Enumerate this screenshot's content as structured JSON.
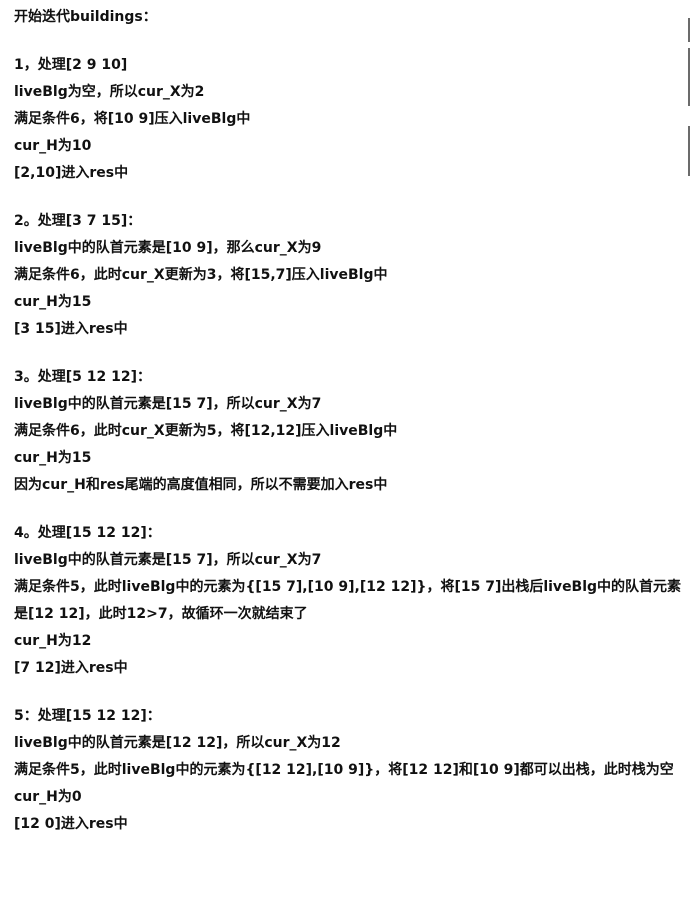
{
  "heading": "开始迭代buildings：",
  "sections": [
    {
      "lines": [
        "1，处理[2  9 10]",
        "liveBlg为空，所以cur_X为2",
        "满足条件6，将[10 9]压入liveBlg中",
        "cur_H为10",
        "[2,10]进入res中"
      ]
    },
    {
      "lines": [
        "2。处理[3 7 15]：",
        "liveBlg中的队首元素是[10 9]，那么cur_X为9",
        "满足条件6，此时cur_X更新为3，将[15,7]压入liveBlg中",
        "cur_H为15",
        "[3 15]进入res中"
      ]
    },
    {
      "lines": [
        "3。处理[5 12 12]：",
        "liveBlg中的队首元素是[15 7]，所以cur_X为7",
        "满足条件6，此时cur_X更新为5，将[12,12]压入liveBlg中",
        "cur_H为15",
        "因为cur_H和res尾端的高度值相同，所以不需要加入res中"
      ]
    },
    {
      "lines": [
        "4。处理[15 12 12]：",
        "liveBlg中的队首元素是[15 7]，所以cur_X为7",
        "满足条件5，此时liveBlg中的元素为{[15 7],[10 9],[12 12]}，将[15 7]出栈后liveBlg中的队首元素是[12 12]，此时12>7，故循环一次就结束了",
        "cur_H为12",
        "[7 12]进入res中"
      ]
    },
    {
      "lines": [
        "5：处理[15 12 12]：",
        "liveBlg中的队首元素是[12 12]，所以cur_X为12",
        "满足条件5，此时liveBlg中的元素为{[12 12],[10 9]}，将[12 12]和[10 9]都可以出栈，此时栈为空",
        "cur_H为0",
        "[12 0]进入res中"
      ]
    }
  ]
}
